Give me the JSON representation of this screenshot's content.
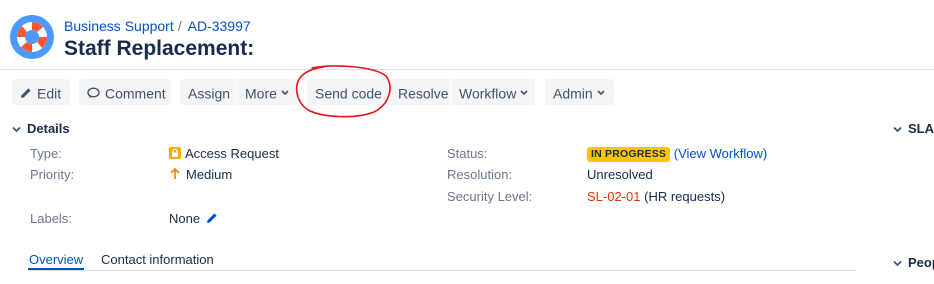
{
  "header": {
    "breadcrumb": [
      "Business Support",
      "AD-33997"
    ],
    "title": "Staff Replacement:"
  },
  "toolbar": {
    "edit": "Edit",
    "comment": "Comment",
    "assign": "Assign",
    "more": "More",
    "send_code": "Send code",
    "resolve": "Resolve",
    "workflow": "Workflow",
    "admin": "Admin"
  },
  "details": {
    "title": "Details",
    "type": {
      "label": "Type:",
      "value": "Access Request"
    },
    "priority": {
      "label": "Priority:",
      "value": "Medium"
    },
    "labels": {
      "label": "Labels:",
      "value": "None"
    },
    "status": {
      "label": "Status:",
      "value": "IN PROGRESS",
      "link": "(View Workflow)"
    },
    "resolution": {
      "label": "Resolution:",
      "value": "Unresolved"
    },
    "security_level": {
      "label": "Security Level:",
      "value": "SL-02-01",
      "suffix": "(HR requests)"
    }
  },
  "tabs": [
    "Overview",
    "Contact information"
  ],
  "right_panel": {
    "slas": "SLAs",
    "people": "People"
  },
  "colors": {
    "link": "#0052cc",
    "status_lozenge": "#ffc400",
    "security_level": "#de350b",
    "annotation": "#e3151a",
    "priority_arrow": "#ff8b00",
    "type_icon": "#ffab00"
  }
}
